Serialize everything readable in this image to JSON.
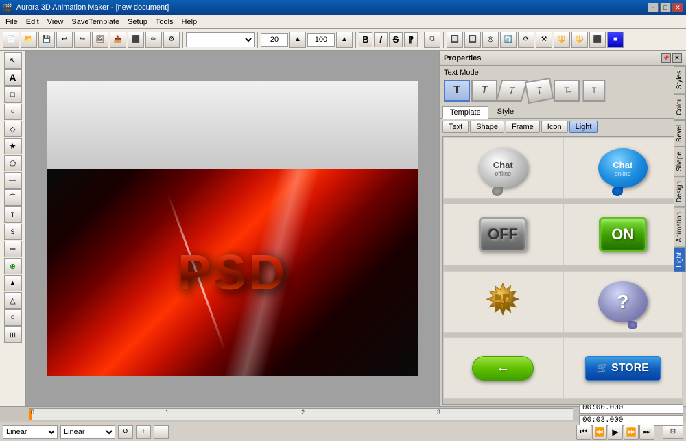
{
  "titleBar": {
    "title": "Aurora 3D Animation Maker - [new document]",
    "controls": [
      "−",
      "□",
      "✕"
    ]
  },
  "menuBar": {
    "items": [
      "File",
      "Edit",
      "View",
      "SaveTemplate",
      "Setup",
      "Tools",
      "Help"
    ]
  },
  "toolbar": {
    "fontSizeValue": "20",
    "fontOpacity": "100",
    "boldLabel": "B",
    "italicLabel": "I",
    "strikeLabel": "S"
  },
  "leftTools": {
    "tools": [
      "↖",
      "A",
      "□",
      "○",
      "◇",
      "★",
      "⬠",
      "—",
      "⌒",
      "T",
      "S",
      "✏",
      "⊕",
      "▲",
      "△",
      "○",
      "⊞"
    ]
  },
  "canvas": {
    "psdText": "PSD"
  },
  "properties": {
    "title": "Properties",
    "textModeLabel": "Text Mode",
    "textModeIcons": [
      "T",
      "T",
      "T",
      "T",
      "T",
      "T"
    ],
    "templateTabLabel": "Template",
    "styleTabLabel": "Style",
    "subTabs": [
      "Text",
      "Shape",
      "Frame",
      "Icon",
      "Light"
    ],
    "activeSubTab": "Light",
    "icons": [
      {
        "type": "chat-offline",
        "label": "Chat offline"
      },
      {
        "type": "chat-online",
        "label": "Chat online"
      },
      {
        "type": "off-button",
        "label": "OFF"
      },
      {
        "type": "on-button",
        "label": "ON"
      },
      {
        "type": "puzzle",
        "label": "Puzzle"
      },
      {
        "type": "question",
        "label": "Question"
      },
      {
        "type": "back-arrow",
        "label": "Back Arrow"
      },
      {
        "type": "store",
        "label": "Store"
      }
    ],
    "rightTabs": [
      "Styles",
      "Color",
      "Bevel",
      "Shape",
      "Design",
      "Animation",
      "Light"
    ]
  },
  "timeline": {
    "markers": [
      "0",
      "1",
      "2",
      "3"
    ],
    "currentTime": "00:00.000",
    "totalTime": "00:03.000"
  },
  "bottomBar": {
    "selectOptions": [
      "",
      "Linear"
    ],
    "selectedOption": "Linear",
    "playButtons": [
      "⏮",
      "⏪",
      "▶",
      "⏩",
      "⏭"
    ]
  }
}
